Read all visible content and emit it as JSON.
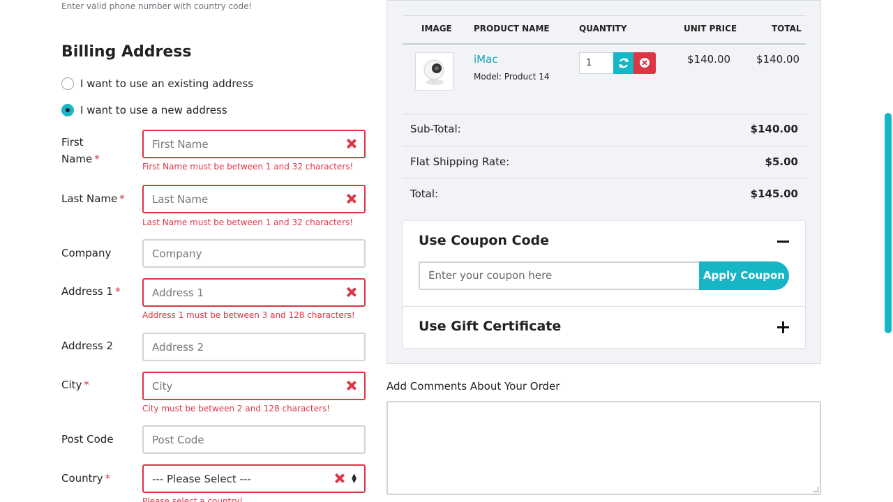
{
  "phone_hint": "Enter valid phone number with country code!",
  "billing": {
    "title": "Billing Address",
    "radio_existing": "I want to use an existing address",
    "radio_new": "I want to use a new address",
    "fields": {
      "first_name": {
        "label_line1": "First",
        "label_line2": "Name",
        "placeholder": "First Name",
        "error": "First Name must be between 1 and 32 characters!"
      },
      "last_name": {
        "label": "Last Name",
        "placeholder": "Last Name",
        "error": "Last Name must be between 1 and 32 characters!"
      },
      "company": {
        "label": "Company",
        "placeholder": "Company"
      },
      "address1": {
        "label": "Address 1",
        "placeholder": "Address 1",
        "error": "Address 1 must be between 3 and 128 characters!"
      },
      "address2": {
        "label": "Address 2",
        "placeholder": "Address 2"
      },
      "city": {
        "label": "City",
        "placeholder": "City",
        "error": "City must be between 2 and 128 characters!"
      },
      "postcode": {
        "label": "Post Code",
        "placeholder": "Post Code"
      },
      "country": {
        "label": "Country",
        "selected": "--- Please Select ---",
        "error": "Please select a country!"
      }
    },
    "required_mark": "*"
  },
  "cart": {
    "headers": {
      "image": "IMAGE",
      "product_name": "PRODUCT NAME",
      "quantity": "QUANTITY",
      "unit_price": "UNIT PRICE",
      "total": "TOTAL"
    },
    "item": {
      "name": "iMac",
      "model": "Model: Product 14",
      "quantity": "1",
      "unit_price": "$140.00",
      "total": "$140.00"
    },
    "summary": {
      "subtotal_label": "Sub-Total:",
      "subtotal_value": "$140.00",
      "shipping_label": "Flat Shipping Rate:",
      "shipping_value": "$5.00",
      "total_label": "Total:",
      "total_value": "$145.00"
    }
  },
  "coupon": {
    "title": "Use Coupon Code",
    "placeholder": "Enter your coupon here",
    "button": "Apply Coupon"
  },
  "gift": {
    "title": "Use Gift Certificate"
  },
  "comments": {
    "label": "Add Comments About Your Order"
  },
  "colors": {
    "accent": "#17b6c6",
    "error": "#dc3545",
    "link": "#17a2b8"
  }
}
